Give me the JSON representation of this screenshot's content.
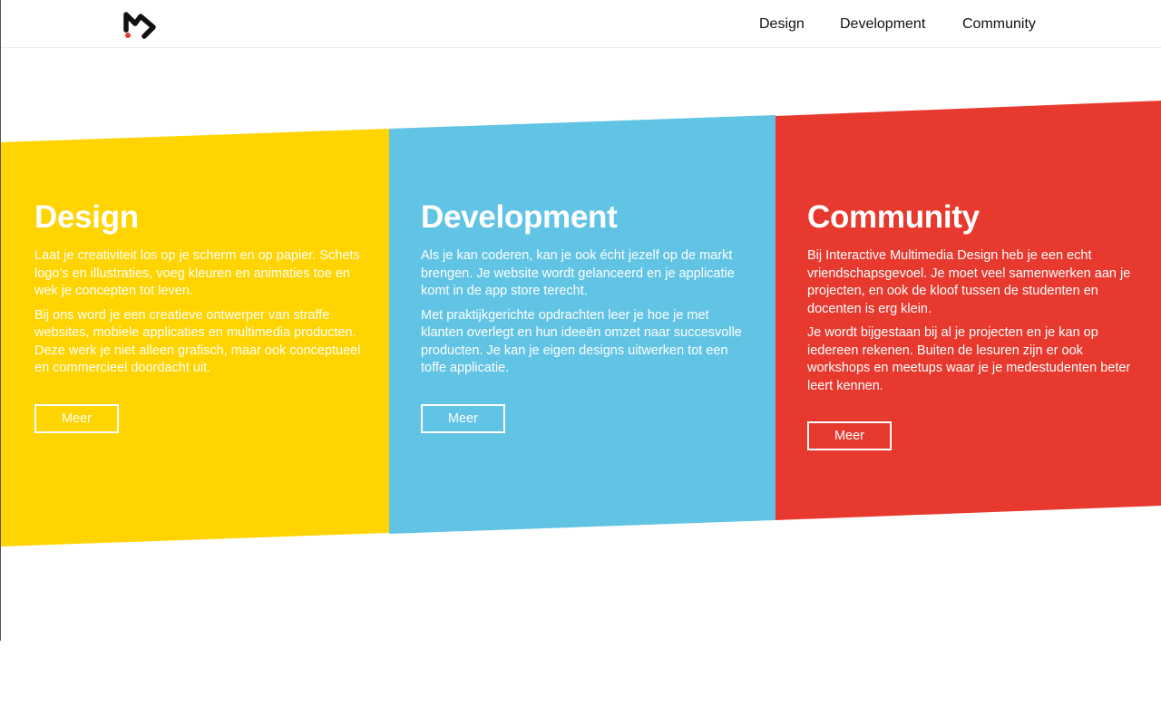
{
  "colors": {
    "yellow": "#ffd400",
    "blue": "#62c4e4",
    "red": "#e8392f",
    "logo_dot": "#e8392f"
  },
  "header": {
    "logo_icon": "m-logo-icon",
    "nav": [
      {
        "label": "Design"
      },
      {
        "label": "Development"
      },
      {
        "label": "Community"
      }
    ]
  },
  "sections": [
    {
      "title": "Design",
      "paragraphs": [
        "Laat je creativiteit los op je scherm en op papier. Schets logo’s en illustraties, voeg kleuren en animaties toe en wek je concepten tot leven.",
        "Bij ons word je een creatieve ontwerper van straffe websites, mobiele applicaties en multimedia producten. Deze werk je niet alleen grafisch, maar ook conceptueel en commercieel doordacht uit."
      ],
      "button": "Meer"
    },
    {
      "title": "Development",
      "paragraphs": [
        "Als je kan coderen, kan je ook écht jezelf op de markt brengen. Je website wordt gelanceerd en je applicatie komt in de app store terecht.",
        "Met praktijkgerichte opdrachten leer je hoe je met klanten overlegt en hun ideeën omzet naar succesvolle producten. Je kan je eigen designs uitwerken tot een toffe applicatie."
      ],
      "button": "Meer"
    },
    {
      "title": "Community",
      "paragraphs": [
        "Bij Interactive Multimedia Design heb je een echt vriendschapsgevoel. Je moet veel samenwerken aan je projecten, en ook de kloof tussen de studenten en docenten is erg klein.",
        "Je wordt bijgestaan bij al je projecten en je kan op iedereen rekenen. Buiten de lesuren zijn er ook workshops en meetups waar je je medestudenten beter leert kennen."
      ],
      "button": "Meer"
    }
  ]
}
